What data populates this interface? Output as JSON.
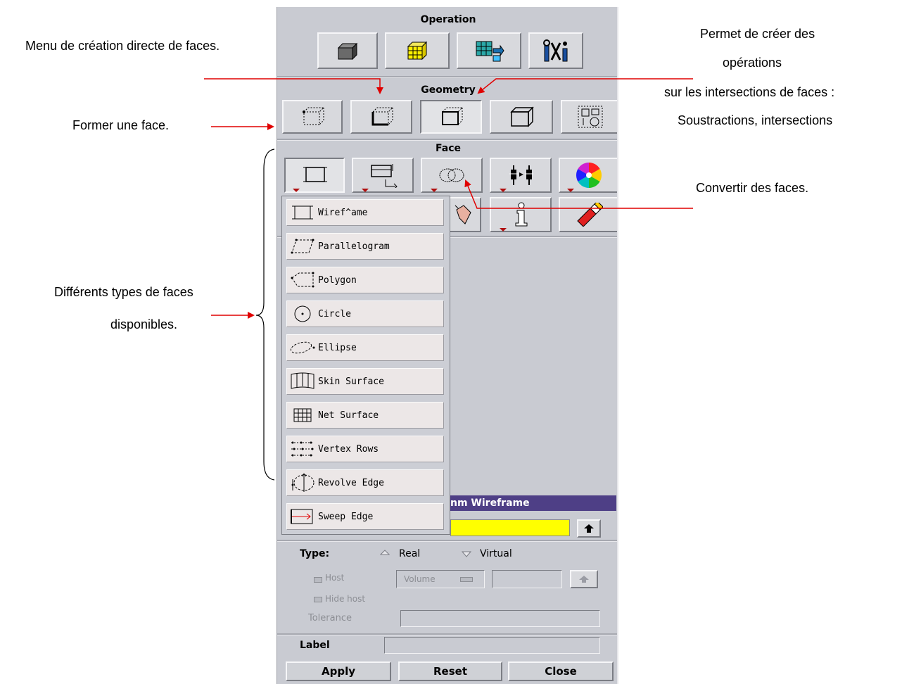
{
  "annotations": {
    "menu_direct": "Menu de création directe de faces.",
    "form_face": "Former une face.",
    "types_line1": "Différents types de faces",
    "types_line2": "disponibles.",
    "ops_line1": "Permet de créer des",
    "ops_line2": "opérations",
    "ops_line3": "sur les intersections de faces :",
    "ops_line4": "Soustractions, intersections",
    "convert": "Convertir des faces."
  },
  "panel": {
    "operation_title": "Operation",
    "geometry_title": "Geometry",
    "face_title": "Face",
    "operation_buttons": [
      "volume-icon",
      "mesh-icon",
      "grid-transfer-icon",
      "tools-icon"
    ],
    "geometry_buttons": [
      "vertex-icon",
      "edge-icon",
      "face-icon",
      "volume-icon",
      "group-icon"
    ],
    "face_buttons_row1": [
      "wireframe-rect-icon",
      "create-face-icon",
      "boolean-icon",
      "connect-icon",
      "color-wheel-icon"
    ],
    "face_buttons_row2": [
      "pointer-icon",
      "info-icon",
      "eraser-icon"
    ]
  },
  "menu": {
    "items": [
      {
        "label": "Wiref^ame",
        "icon": "wireframe-icon"
      },
      {
        "label": "Parallelogram",
        "icon": "parallelogram-icon"
      },
      {
        "label": "Polygon",
        "icon": "polygon-icon"
      },
      {
        "label": "Circle",
        "icon": "circle-icon"
      },
      {
        "label": "Ellipse",
        "icon": "ellipse-icon"
      },
      {
        "label": "Skin Surface",
        "icon": "skin-surface-icon"
      },
      {
        "label": "Net Surface",
        "icon": "net-surface-icon"
      },
      {
        "label": "Vertex Rows",
        "icon": "vertex-rows-icon"
      },
      {
        "label": "Revolve Edge",
        "icon": "revolve-edge-icon"
      },
      {
        "label": "Sweep Edge",
        "icon": "sweep-edge-icon"
      }
    ]
  },
  "form": {
    "title": "nm Wireframe",
    "type_label": "Type:",
    "type_real": "Real",
    "type_virtual": "Virtual",
    "host_label": "Host",
    "volume_option": "Volume",
    "hide_host_label": "Hide host",
    "tolerance_label": "Tolerance",
    "label_label": "Label",
    "apply": "Apply",
    "reset": "Reset",
    "close": "Close"
  },
  "colors": {
    "accent_red": "#e00000",
    "form_title_bar": "#4e3f86",
    "highlight_field": "#ffff00"
  }
}
